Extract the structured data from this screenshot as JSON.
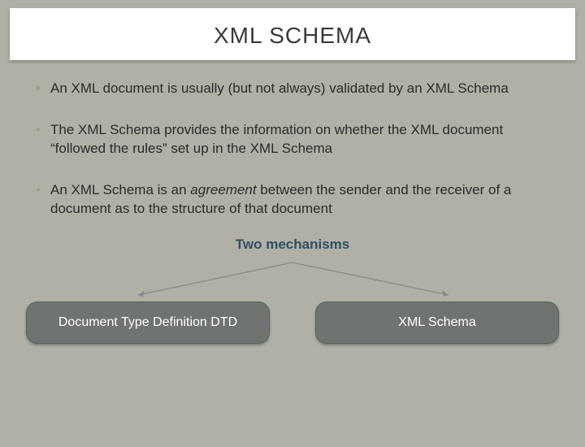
{
  "title": "XML SCHEMA",
  "bullets": [
    {
      "pre": "An XML document is usually (but not always) validated by an XML Schema",
      "italic": "",
      "post": ""
    },
    {
      "pre": "The XML Schema provides the information on whether the XML document “followed the rules” set up in the XML Schema",
      "italic": "",
      "post": ""
    },
    {
      "pre": "An XML Schema is an ",
      "italic": "agreement",
      "post": " between the sender and the receiver of a document as to the structure of that document"
    }
  ],
  "subhead": "Two mechanisms",
  "pills": {
    "left": "Document Type Definition DTD",
    "right": "XML Schema"
  }
}
